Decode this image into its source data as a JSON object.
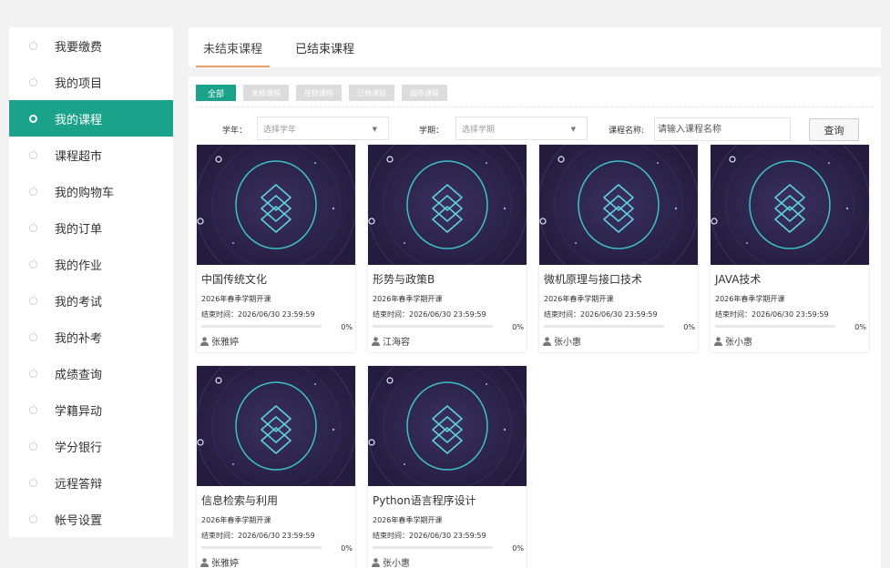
{
  "sidebar": {
    "items": [
      {
        "label": "我要缴费",
        "active": false
      },
      {
        "label": "我的项目",
        "active": false
      },
      {
        "label": "我的课程",
        "active": true
      },
      {
        "label": "课程超市",
        "active": false
      },
      {
        "label": "我的购物车",
        "active": false
      },
      {
        "label": "我的订单",
        "active": false
      },
      {
        "label": "我的作业",
        "active": false
      },
      {
        "label": "我的考试",
        "active": false
      },
      {
        "label": "我的补考",
        "active": false
      },
      {
        "label": "成绩查询",
        "active": false
      },
      {
        "label": "学籍异动",
        "active": false
      },
      {
        "label": "学分银行",
        "active": false
      },
      {
        "label": "远程答辩",
        "active": false
      },
      {
        "label": "帐号设置",
        "active": false
      }
    ]
  },
  "tabs": [
    {
      "label": "未结束课程",
      "active": true
    },
    {
      "label": "已结束课程",
      "active": false
    }
  ],
  "filters": [
    {
      "label": "全部",
      "active": true
    },
    {
      "label": "未修课程",
      "active": false
    },
    {
      "label": "在修课程",
      "active": false
    },
    {
      "label": "已修课程",
      "active": false
    },
    {
      "label": "超市课程",
      "active": false
    }
  ],
  "search": {
    "year_label": "学年：",
    "year_value": "选择学年",
    "term_label": "学期：",
    "term_value": "选择学期",
    "name_label": "课程名称:",
    "name_placeholder": "请输入课程名称",
    "button_label": "查询"
  },
  "colors": {
    "accent": "#1aa38a",
    "tab_underline": "#e7a06a",
    "thumb_bg": "#2b2346"
  },
  "courses": [
    {
      "title": "中国传统文化",
      "term": "2026年春季学期开课",
      "end": "结束时间：2026/06/30 23:59:59",
      "progress": "0%",
      "teacher": "张雅婷"
    },
    {
      "title": "形势与政策B",
      "term": "2026年春季学期开课",
      "end": "结束时间：2026/06/30 23:59:59",
      "progress": "0%",
      "teacher": "江海容"
    },
    {
      "title": "微机原理与接口技术",
      "term": "2026年春季学期开课",
      "end": "结束时间：2026/06/30 23:59:59",
      "progress": "0%",
      "teacher": "张小惠"
    },
    {
      "title": "JAVA技术",
      "term": "2026年春季学期开课",
      "end": "结束时间：2026/06/30 23:59:59",
      "progress": "0%",
      "teacher": "张小惠"
    },
    {
      "title": "信息检索与利用",
      "term": "2026年春季学期开课",
      "end": "结束时间：2026/06/30 23:59:59",
      "progress": "0%",
      "teacher": "张雅婷"
    },
    {
      "title": "Python语言程序设计",
      "term": "2026年春季学期开课",
      "end": "结束时间：2026/06/30 23:59:59",
      "progress": "0%",
      "teacher": "张小惠"
    }
  ]
}
